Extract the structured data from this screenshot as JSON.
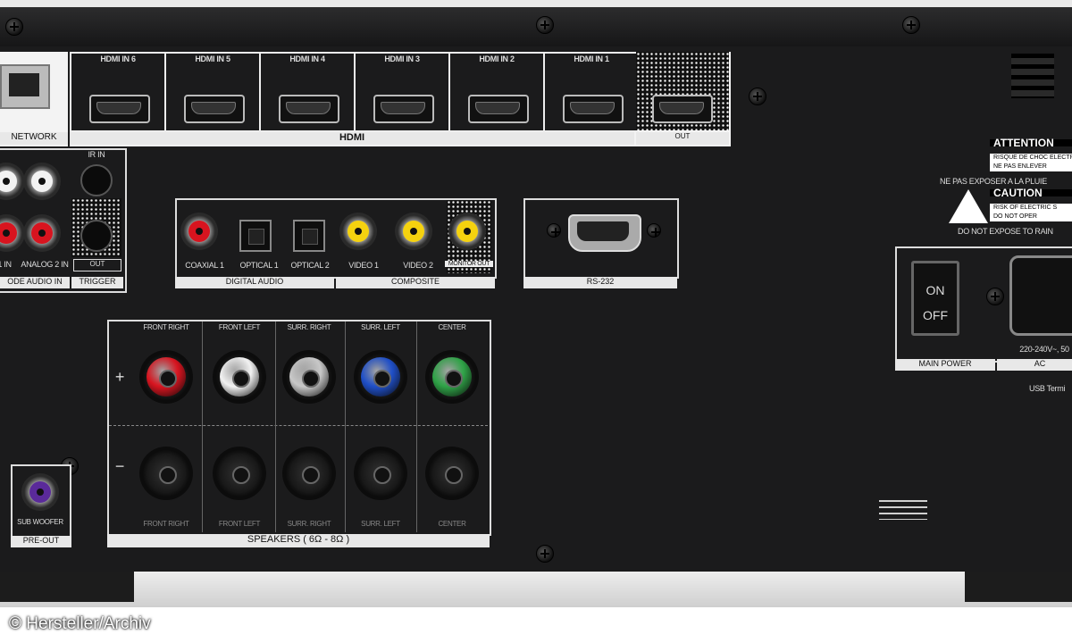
{
  "hdmi": {
    "inputs": [
      "IN 6",
      "IN 5",
      "IN 4",
      "IN 3",
      "IN 2",
      "IN 1"
    ],
    "logo": "HDMI",
    "out_label": "OUT",
    "section_label": "HDMI"
  },
  "network": {
    "label": "NETWORK"
  },
  "analog": {
    "ports": [
      "ANALOG 2 IN"
    ],
    "partial_labels": [
      "1 IN"
    ],
    "section_label": "ODE AUDIO IN"
  },
  "trigger": {
    "ir_in": "IR IN",
    "out": "OUT",
    "section_label": "TRIGGER"
  },
  "digital_audio": {
    "ports": [
      "COAXIAL 1",
      "OPTICAL 1",
      "OPTICAL 2"
    ],
    "section_label": "DIGITAL AUDIO"
  },
  "composite": {
    "ports": [
      "VIDEO 1",
      "VIDEO 2",
      "MONITOR OUT"
    ],
    "section_label": "COMPOSITE"
  },
  "rs232": {
    "label": "RS-232"
  },
  "warnings": {
    "attention": "ATTENTION",
    "attention_lines": [
      "RISQUE DE CHOC ELECTR",
      "NE PAS ENLEVER"
    ],
    "no_rain_fr": "NE PAS EXPOSER A LA PLUIE",
    "caution": "CAUTION",
    "caution_lines": [
      "RISK OF ELECTRIC S",
      "DO NOT OPER"
    ],
    "no_rain_en": "DO NOT EXPOSE TO RAIN"
  },
  "power": {
    "switch_on": "ON",
    "switch_off": "OFF",
    "main_power": "MAIN POWER",
    "ac_label": "AC",
    "voltage": "220-240V~, 50",
    "usb_note": "USB Termi"
  },
  "speakers": {
    "plus": "+",
    "minus": "−",
    "top_labels": [
      "FRONT RIGHT",
      "FRONT LEFT",
      "SURR. RIGHT",
      "SURR. LEFT",
      "CENTER"
    ],
    "bottom_labels": [
      "FRONT RIGHT",
      "FRONT LEFT",
      "SURR. RIGHT",
      "SURR. LEFT",
      "CENTER"
    ],
    "section_label": "SPEAKERS ( 6Ω - 8Ω )",
    "colors": [
      "#d8141f",
      "#f2f2f2",
      "#c8c8c8",
      "#1f4fc8",
      "#2fa347"
    ]
  },
  "preout": {
    "port": "SUB WOOFER",
    "section_label": "PRE-OUT",
    "color": "#5a2a9a"
  },
  "credit": "© Hersteller/Archiv"
}
